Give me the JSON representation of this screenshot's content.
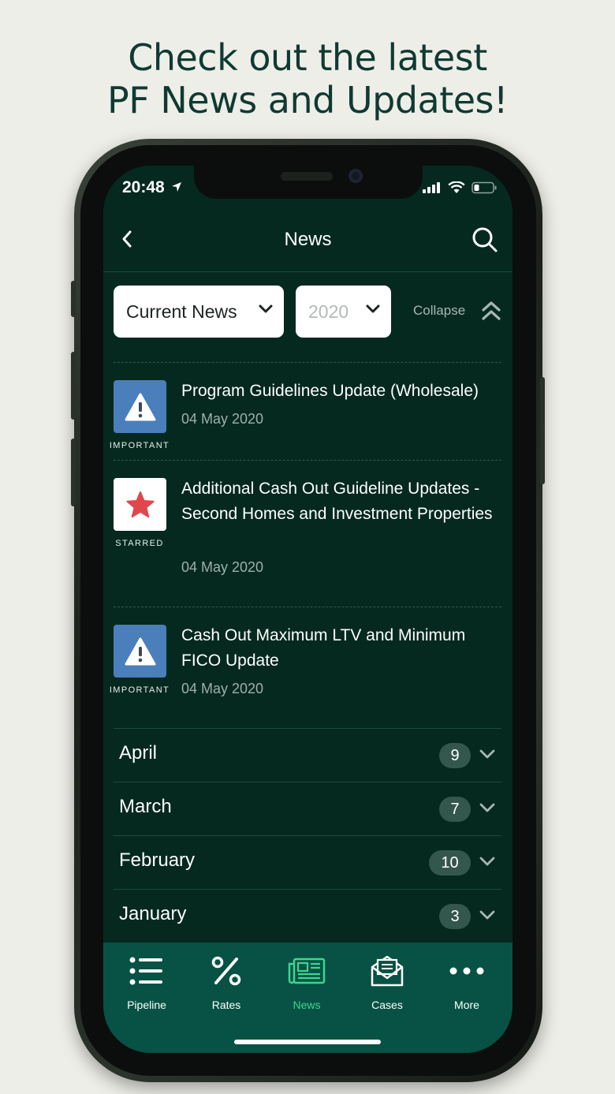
{
  "headline": {
    "line1": "Check out the latest",
    "line2": "PF News and Updates!"
  },
  "status_bar": {
    "time": "20:48"
  },
  "header": {
    "title": "News"
  },
  "filters": {
    "category_selected": "Current News",
    "year_selected": "2020",
    "collapse_label": "Collapse"
  },
  "news_items": [
    {
      "badge_label": "IMPORTANT",
      "badge_icon": "warning-icon",
      "title": "Program Guidelines Update (Wholesale)",
      "date": "04 May 2020"
    },
    {
      "badge_label": "STARRED",
      "badge_icon": "star-icon",
      "title": "Additional Cash Out Guideline Updates - Second Homes and Investment Properties",
      "date": "04 May 2020"
    },
    {
      "badge_label": "IMPORTANT",
      "badge_icon": "warning-icon",
      "title": "Cash Out Maximum LTV and Minimum FICO Update",
      "date": "04 May 2020"
    }
  ],
  "months": [
    {
      "label": "April",
      "count": "9"
    },
    {
      "label": "March",
      "count": "7"
    },
    {
      "label": "February",
      "count": "10"
    },
    {
      "label": "January",
      "count": "3"
    }
  ],
  "tabs": [
    {
      "label": "Pipeline",
      "icon": "list-icon"
    },
    {
      "label": "Rates",
      "icon": "percent-icon"
    },
    {
      "label": "News",
      "icon": "newspaper-icon",
      "active": true
    },
    {
      "label": "Cases",
      "icon": "envelope-icon"
    },
    {
      "label": "More",
      "icon": "more-dots-icon"
    }
  ],
  "colors": {
    "background": "#05291f",
    "tabbar": "#075244",
    "active_tab": "#3fd58f",
    "important_tile": "#4a7fbb",
    "star": "#e0474c"
  }
}
